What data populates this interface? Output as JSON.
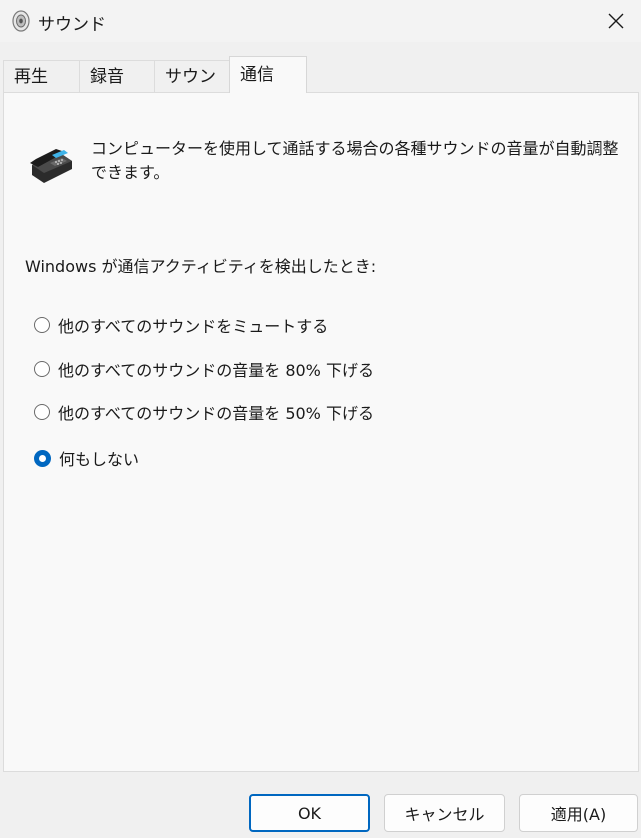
{
  "window": {
    "title": "サウンド"
  },
  "tabs": [
    {
      "label": "再生",
      "active": false
    },
    {
      "label": "録音",
      "active": false
    },
    {
      "label": "サウンド",
      "active": false
    },
    {
      "label": "通信",
      "active": true
    }
  ],
  "communications": {
    "description_line1": "コンピューターを使用して通話する場合の各種サウンドの音量が自動調整",
    "description_line2": "できます。",
    "when_label": "Windows が通信アクティビティを検出したとき:",
    "options": [
      {
        "label": "他のすべてのサウンドをミュートする",
        "checked": false
      },
      {
        "label": "他のすべてのサウンドの音量を 80% 下げる",
        "checked": false
      },
      {
        "label": "他のすべてのサウンドの音量を 50% 下げる",
        "checked": false
      },
      {
        "label": "何もしない",
        "checked": true
      }
    ]
  },
  "buttons": {
    "ok": "OK",
    "cancel": "キャンセル",
    "apply": "適用(A)"
  },
  "colors": {
    "accent": "#0067c0",
    "panel_bg": "#f9f9f9",
    "window_bg": "#f0f0f0"
  },
  "icons": {
    "app": "speaker-icon",
    "close": "close-icon",
    "phone": "telephone-icon"
  }
}
